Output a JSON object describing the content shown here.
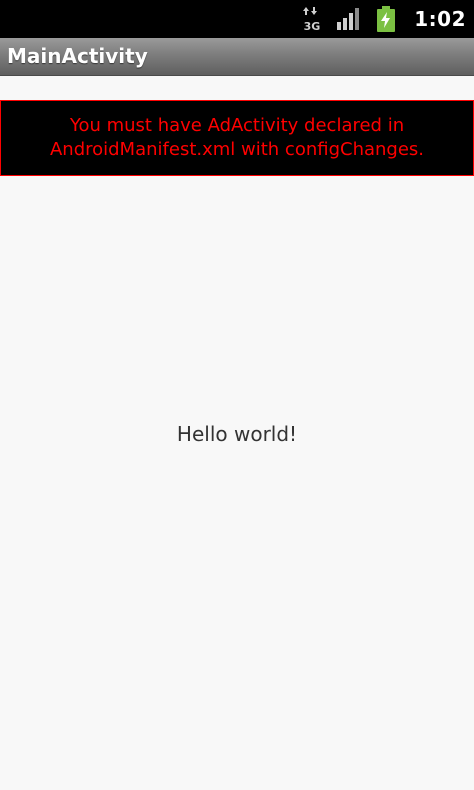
{
  "status_bar": {
    "network_label": "3G",
    "time": "1:02",
    "icons": [
      "data-arrows-icon",
      "signal-strength-icon",
      "battery-charging-icon"
    ],
    "battery_color": "#7bc042"
  },
  "app_bar": {
    "title": "MainActivity"
  },
  "ad_banner": {
    "message": "You must have AdActivity declared in AndroidManifest.xml with configChanges.",
    "text_color": "#ff0000",
    "border_color": "#ff0000",
    "background": "#000000"
  },
  "main": {
    "hello_text": "Hello world!"
  }
}
